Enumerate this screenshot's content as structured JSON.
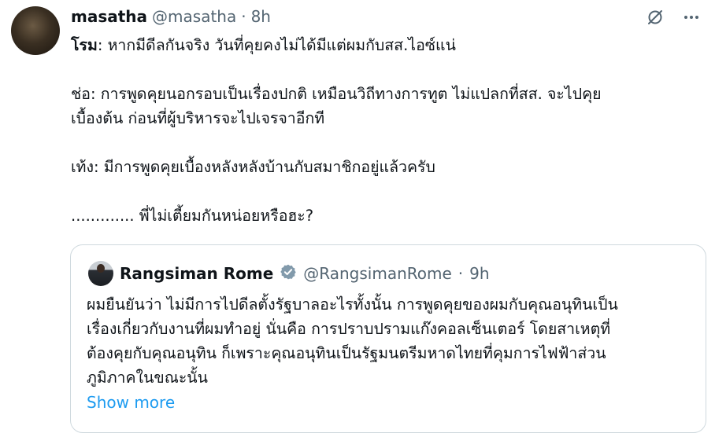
{
  "author": {
    "name": "masatha",
    "handle": "@masatha",
    "separator": "·",
    "time": "8h"
  },
  "icons": {
    "grok": "grok-icon",
    "more": "more-icon",
    "verified": "verified-badge-icon"
  },
  "tweet": {
    "lines": [
      {
        "speaker": "โรม",
        "text": ": หากมีดีลกันจริง วันที่คุยคงไม่ได้มีแต่ผมกับสส.ไอซ์แน่"
      },
      {
        "text": "ช่อ: การพูดคุยนอกรอบเป็นเรื่องปกติ เหมือนวิถีทางการทูต ไม่แปลกที่สส. จะไปคุย"
      },
      {
        "text": "เบื้องต้น ก่อนที่ผู้บริหารจะไปเจรจาอีกที"
      },
      {
        "text": "เท้ง: มีการพูดคุยเบื้องหลังหลังบ้านกับสมาชิกอยู่แล้วครับ"
      },
      {
        "text": "............. พี่ไม่เตี้ยมกันหน่อยหรือฮะ?"
      }
    ]
  },
  "quote": {
    "name": "Rangsiman Rome",
    "handle": "@RangsimanRome",
    "separator": "·",
    "time": "9h",
    "lines": [
      "ผมยืนยันว่า ไม่มีการไปดีลตั้งรัฐบาลอะไรทั้งนั้น การพูดคุยของผมกับคุณอนุทินเป็น",
      "เรื่องเกี่ยวกับงานที่ผมทำอยู่ นั่นคือ การปราบปรามแก๊งคอลเซ็นเตอร์ โดยสาเหตุที่",
      "ต้องคุยกับคุณอนุทิน ก็เพราะคุณอนุทินเป็นรัฐมนตรีมหาดไทยที่คุมการไฟฟ้าส่วน",
      "ภูมิภาคในขณะนั้น"
    ],
    "show_more": "Show more"
  },
  "colors": {
    "text": "#0f1419",
    "secondary": "#536471",
    "link": "#1d9bf0",
    "border": "#cfd9de",
    "verified": "#829aab"
  }
}
